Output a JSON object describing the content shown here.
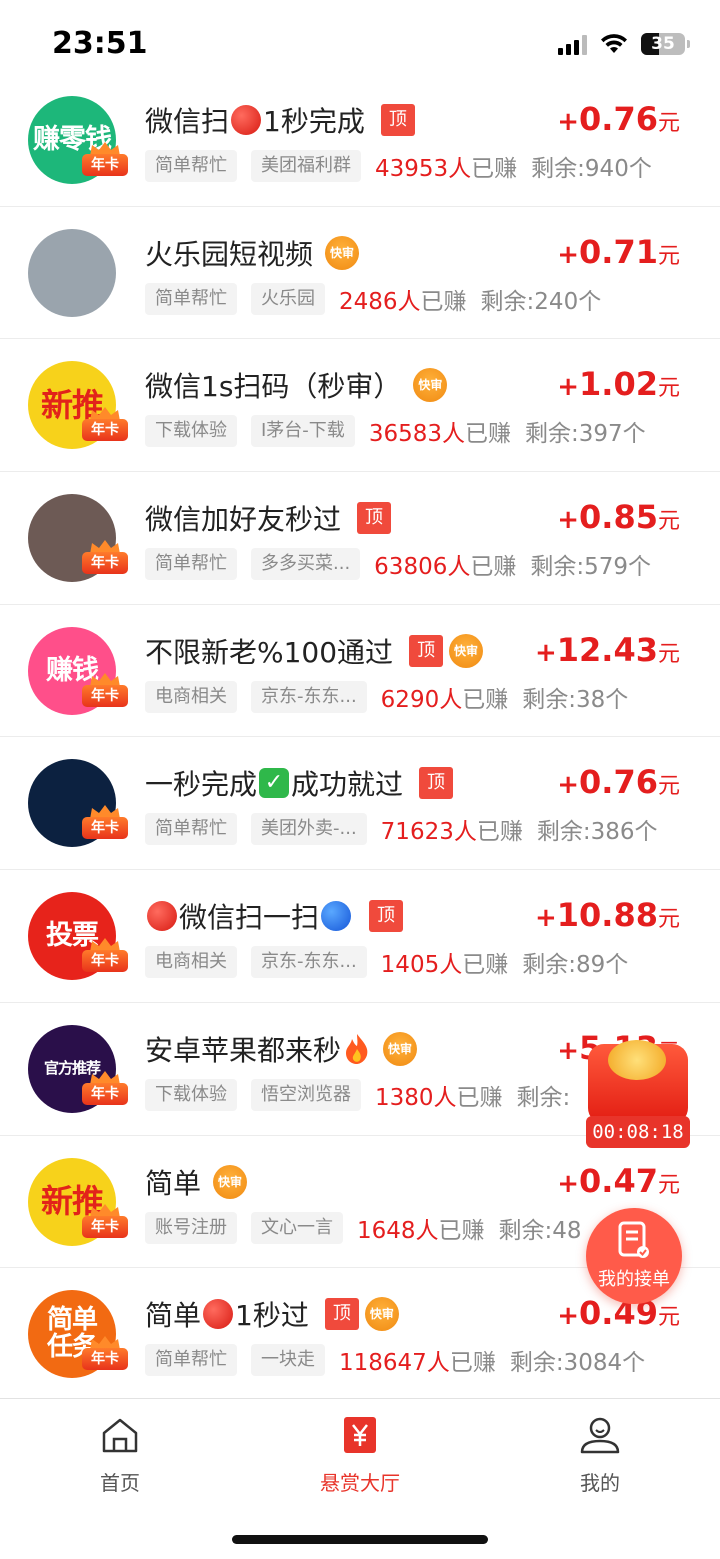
{
  "status_bar": {
    "time": "23:51",
    "battery": "35"
  },
  "tasks": [
    {
      "title_parts": [
        "微信扫",
        "1秒完成"
      ],
      "emoji": [
        "red"
      ],
      "top": true,
      "fast": false,
      "price_plus": "+",
      "price": "0.76",
      "unit": "元",
      "chip1": "简单帮忙",
      "chip2": "美团福利群",
      "count": "43953人",
      "earned": "已赚",
      "remaining": "剩余:940个",
      "avatar_text": "赚零钱",
      "avatar_color": "#1db77a",
      "vip": "年卡"
    },
    {
      "title_parts": [
        "火乐园短视频"
      ],
      "emoji": [],
      "top": false,
      "fast": true,
      "price_plus": "+",
      "price": "0.71",
      "unit": "元",
      "chip1": "简单帮忙",
      "chip2": "火乐园",
      "count": "2486人",
      "earned": "已赚",
      "remaining": "剩余:240个",
      "avatar_text": "",
      "avatar_color": "#9aa4ad",
      "vip": ""
    },
    {
      "title_parts": [
        "微信1s扫码（秒审）"
      ],
      "emoji": [],
      "top": false,
      "fast": true,
      "price_plus": "+",
      "price": "1.02",
      "unit": "元",
      "chip1": "下载体验",
      "chip2": "I茅台-下载",
      "count": "36583人",
      "earned": "已赚",
      "remaining": "剩余:397个",
      "avatar_text": "新推",
      "avatar_color": "#f7d21b",
      "vip": "年卡"
    },
    {
      "title_parts": [
        "微信加好友秒过"
      ],
      "emoji": [],
      "top": true,
      "fast": false,
      "price_plus": "+",
      "price": "0.85",
      "unit": "元",
      "chip1": "简单帮忙",
      "chip2": "多多买菜...",
      "count": "63806人",
      "earned": "已赚",
      "remaining": "剩余:579个",
      "avatar_text": "",
      "avatar_color": "#6d5a55",
      "vip": "年卡"
    },
    {
      "title_parts": [
        "不限新老%100通过"
      ],
      "emoji": [],
      "top": true,
      "fast": true,
      "price_plus": "+",
      "price": "12.43",
      "unit": "元",
      "chip1": "电商相关",
      "chip2": "京东-东东...",
      "count": "6290人",
      "earned": "已赚",
      "remaining": "剩余:38个",
      "avatar_text": "赚钱",
      "avatar_color": "#ff4f8a",
      "vip": "年卡"
    },
    {
      "title_parts": [
        "一秒完成",
        "成功就过"
      ],
      "emoji": [
        "check"
      ],
      "top": true,
      "fast": false,
      "price_plus": "+",
      "price": "0.76",
      "unit": "元",
      "chip1": "简单帮忙",
      "chip2": "美团外卖-...",
      "count": "71623人",
      "earned": "已赚",
      "remaining": "剩余:386个",
      "avatar_text": "",
      "avatar_color": "#0c2140",
      "vip": "年卡"
    },
    {
      "title_parts": [
        "",
        "微信扫一扫",
        ""
      ],
      "emoji": [
        "red",
        "blue"
      ],
      "top": true,
      "fast": false,
      "price_plus": "+",
      "price": "10.88",
      "unit": "元",
      "chip1": "电商相关",
      "chip2": "京东-东东...",
      "count": "1405人",
      "earned": "已赚",
      "remaining": "剩余:89个",
      "avatar_text": "投票",
      "avatar_color": "#e7231b",
      "vip": "年卡"
    },
    {
      "title_parts": [
        "安卓苹果都来秒"
      ],
      "emoji": [
        "fire"
      ],
      "top": false,
      "fast": true,
      "price_plus": "+",
      "price": "5.13",
      "unit": "元",
      "chip1": "下载体验",
      "chip2": "悟空浏览器",
      "count": "1380人",
      "earned": "已赚",
      "remaining": "剩余:",
      "avatar_text": "官方推荐",
      "avatar_color": "#2a0f4a",
      "vip": "年卡"
    },
    {
      "title_parts": [
        "简单"
      ],
      "emoji": [],
      "top": false,
      "fast": true,
      "price_plus": "+",
      "price": "0.47",
      "unit": "元",
      "chip1": "账号注册",
      "chip2": "文心一言",
      "count": "1648人",
      "earned": "已赚",
      "remaining": "剩余:48",
      "avatar_text": "新推",
      "avatar_color": "#f7d21b",
      "vip": "年卡"
    },
    {
      "title_parts": [
        "简单",
        "1秒过"
      ],
      "emoji": [
        "red"
      ],
      "top": true,
      "fast": true,
      "price_plus": "+",
      "price": "0.49",
      "unit": "元",
      "chip1": "简单帮忙",
      "chip2": "一块走",
      "count": "118647人",
      "earned": "已赚",
      "remaining": "剩余:3084个",
      "avatar_text": "简单任务",
      "avatar_color": "#f26a12",
      "vip": "年卡"
    }
  ],
  "labels": {
    "top_tag": "顶",
    "fast_tag": "快审"
  },
  "float": {
    "timer": "00:08:18",
    "my_orders": "我的接单"
  },
  "tab_bar": {
    "home": "首页",
    "hall": "悬赏大厅",
    "mine": "我的",
    "active_color": "#e8342a"
  }
}
